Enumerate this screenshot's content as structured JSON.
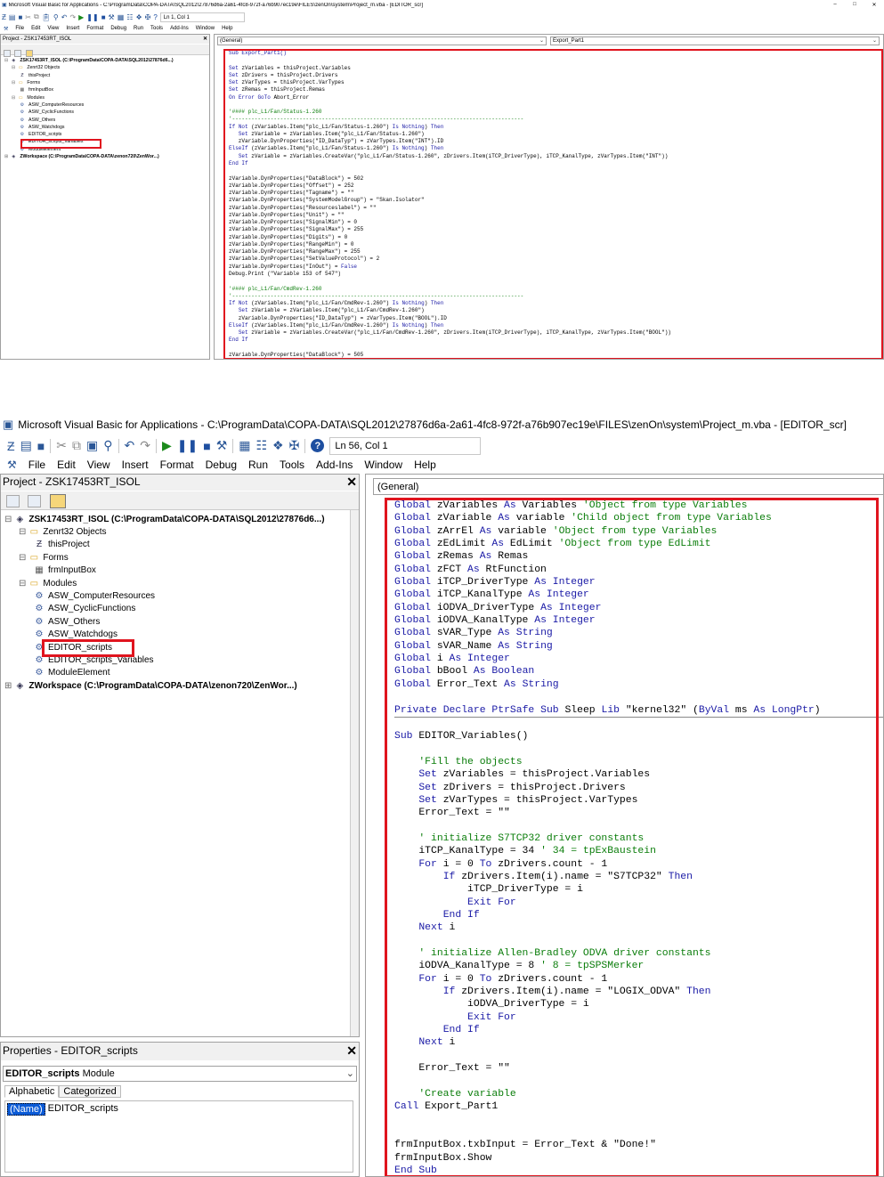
{
  "window1": {
    "title": "Microsoft Visual Basic for Applications - C:\\ProgramData\\COPA-DATA\\SQL2012\\27876d6a-2a61-4fc8-972f-a76b907ec19e\\FILES\\zenOn\\system\\Project_m.vba - [EDITOR_scr]",
    "window_buttons": [
      "–",
      "□",
      "✕"
    ],
    "status": "Ln 1, Col 1",
    "menu": [
      "File",
      "Edit",
      "View",
      "Insert",
      "Format",
      "Debug",
      "Run",
      "Tools",
      "Add-Ins",
      "Window",
      "Help"
    ],
    "project_title": "Project - ZSK17453RT_ISOL",
    "tree": [
      {
        "label": "ZSK17453RT_ISOL (C:\\ProgramData\\COPA-DATA\\SQL2012\\27876d6...)",
        "icon": "project-icon",
        "bold": true,
        "level": 0
      },
      {
        "label": "Zenrt32 Objects",
        "icon": "folder-icon",
        "level": 1
      },
      {
        "label": "thisProject",
        "icon": "object-icon",
        "level": 2
      },
      {
        "label": "Forms",
        "icon": "folder-icon",
        "level": 1
      },
      {
        "label": "frmInputBox",
        "icon": "form-icon",
        "level": 2
      },
      {
        "label": "Modules",
        "icon": "folder-icon",
        "level": 1
      },
      {
        "label": "ASW_ComputerResources",
        "icon": "module-icon",
        "level": 2
      },
      {
        "label": "ASW_CyclicFunctions",
        "icon": "module-icon",
        "level": 2
      },
      {
        "label": "ASW_Others",
        "icon": "module-icon",
        "level": 2
      },
      {
        "label": "ASW_Watchdogs",
        "icon": "module-icon",
        "level": 2
      },
      {
        "label": "EDITOR_scripts",
        "icon": "module-icon",
        "level": 2
      },
      {
        "label": "EDITOR_scripts_Variables",
        "icon": "module-icon",
        "level": 2
      },
      {
        "label": "ModuleElement",
        "icon": "module-icon",
        "level": 2
      },
      {
        "label": "ZWorkspace (C:\\ProgramData\\COPA-DATA\\zenon720\\ZenWor...)",
        "icon": "project-icon",
        "bold": true,
        "level": 0
      }
    ],
    "combo_left": "(General)",
    "combo_right": "Export_Part1",
    "code": [
      {
        "t": "Sub Export_Part1()",
        "c": "kw"
      },
      {
        "t": "",
        "c": ""
      },
      {
        "t": "Set zVariables = thisProject.Variables",
        "c": ""
      },
      {
        "t": "Set zDrivers = thisProject.Drivers",
        "c": ""
      },
      {
        "t": "Set zVarTypes = thisProject.VarTypes",
        "c": ""
      },
      {
        "t": "Set zRemas = thisProject.Remas",
        "c": ""
      },
      {
        "t": "On Error GoTo Abort_Error",
        "c": ""
      },
      {
        "t": "",
        "c": ""
      },
      {
        "t": "'#### plc_L1/Fan/Status-1.260",
        "c": "cm"
      },
      {
        "t": "'-------------------------------------------------------------------------------------------",
        "c": "cm"
      },
      {
        "t": "If Not (zVariables.Item(\"plc_L1/Fan/Status-1.260\") Is Nothing) Then",
        "c": ""
      },
      {
        "t": "   Set zVariable = zVariables.Item(\"plc_L1/Fan/Status-1.260\")",
        "c": ""
      },
      {
        "t": "   zVariable.DynProperties(\"ID_DataTyp\") = zVarTypes.Item(\"INT\").ID",
        "c": ""
      },
      {
        "t": "ElseIf (zVariables.Item(\"plc_L1/Fan/Status-1.260\") Is Nothing) Then",
        "c": ""
      },
      {
        "t": "   Set zVariable = zVariables.CreateVar(\"plc_L1/Fan/Status-1.260\", zDrivers.Item(iTCP_DriverType), iTCP_KanalType, zVarTypes.Item(\"INT\"))",
        "c": ""
      },
      {
        "t": "End If",
        "c": ""
      },
      {
        "t": "",
        "c": ""
      },
      {
        "t": "zVariable.DynProperties(\"DataBlock\") = 502",
        "c": ""
      },
      {
        "t": "zVariable.DynProperties(\"Offset\") = 252",
        "c": ""
      },
      {
        "t": "zVariable.DynProperties(\"Tagname\") = \"\"",
        "c": ""
      },
      {
        "t": "zVariable.DynProperties(\"SystemModelGroup\") = \"Skan.Isolator\"",
        "c": ""
      },
      {
        "t": "zVariable.DynProperties(\"Resourceslabel\") = \"\"",
        "c": ""
      },
      {
        "t": "zVariable.DynProperties(\"Unit\") = \"\"",
        "c": ""
      },
      {
        "t": "zVariable.DynProperties(\"SignalMin\") = 0",
        "c": ""
      },
      {
        "t": "zVariable.DynProperties(\"SignalMax\") = 255",
        "c": ""
      },
      {
        "t": "zVariable.DynProperties(\"Digits\") = 0",
        "c": ""
      },
      {
        "t": "zVariable.DynProperties(\"RangeMin\") = 0",
        "c": ""
      },
      {
        "t": "zVariable.DynProperties(\"RangeMax\") = 255",
        "c": ""
      },
      {
        "t": "zVariable.DynProperties(\"SetValueProtocol\") = 2",
        "c": ""
      },
      {
        "t": "zVariable.DynProperties(\"InOut\") = False",
        "c": ""
      },
      {
        "t": "Debug.Print (\"Variable 153 of 547\")",
        "c": ""
      },
      {
        "t": "",
        "c": ""
      },
      {
        "t": "'#### plc_L1/Fan/CmdRev-1.260",
        "c": "cm"
      },
      {
        "t": "'-------------------------------------------------------------------------------------------",
        "c": "cm"
      },
      {
        "t": "If Not (zVariables.Item(\"plc_L1/Fan/CmdRev-1.260\") Is Nothing) Then",
        "c": ""
      },
      {
        "t": "   Set zVariable = zVariables.Item(\"plc_L1/Fan/CmdRev-1.260\")",
        "c": ""
      },
      {
        "t": "   zVariable.DynProperties(\"ID_DataTyp\") = zVarTypes.Item(\"BOOL\").ID",
        "c": ""
      },
      {
        "t": "ElseIf (zVariables.Item(\"plc_L1/Fan/CmdRev-1.260\") Is Nothing) Then",
        "c": ""
      },
      {
        "t": "   Set zVariable = zVariables.CreateVar(\"plc_L1/Fan/CmdRev-1.260\", zDrivers.Item(iTCP_DriverType), iTCP_KanalType, zVarTypes.Item(\"BOOL\"))",
        "c": ""
      },
      {
        "t": "End If",
        "c": ""
      },
      {
        "t": "",
        "c": ""
      },
      {
        "t": "zVariable.DynProperties(\"DataBlock\") = 505",
        "c": ""
      }
    ]
  },
  "window2": {
    "title": "Microsoft Visual Basic for Applications - C:\\ProgramData\\COPA-DATA\\SQL2012\\27876d6a-2a61-4fc8-972f-a76b907ec19e\\FILES\\zenOn\\system\\Project_m.vba - [EDITOR_scr]",
    "status": "Ln 56, Col 1",
    "menu": [
      "File",
      "Edit",
      "View",
      "Insert",
      "Format",
      "Debug",
      "Run",
      "Tools",
      "Add-Ins",
      "Window",
      "Help"
    ],
    "project_title": "Project - ZSK17453RT_ISOL",
    "tree": [
      {
        "label": "ZSK17453RT_ISOL (C:\\ProgramData\\COPA-DATA\\SQL2012\\27876d6...)",
        "icon": "project-icon",
        "bold": true,
        "level": 0
      },
      {
        "label": "Zenrt32 Objects",
        "icon": "folder-icon",
        "level": 1
      },
      {
        "label": "thisProject",
        "icon": "object-icon",
        "level": 2
      },
      {
        "label": "Forms",
        "icon": "folder-icon",
        "level": 1
      },
      {
        "label": "frmInputBox",
        "icon": "form-icon",
        "level": 2
      },
      {
        "label": "Modules",
        "icon": "folder-icon",
        "level": 1
      },
      {
        "label": "ASW_ComputerResources",
        "icon": "module-icon",
        "level": 2
      },
      {
        "label": "ASW_CyclicFunctions",
        "icon": "module-icon",
        "level": 2
      },
      {
        "label": "ASW_Others",
        "icon": "module-icon",
        "level": 2
      },
      {
        "label": "ASW_Watchdogs",
        "icon": "module-icon",
        "level": 2
      },
      {
        "label": "EDITOR_scripts",
        "icon": "module-icon",
        "level": 2
      },
      {
        "label": "EDITOR_scripts_Variables",
        "icon": "module-icon",
        "level": 2
      },
      {
        "label": "ModuleElement",
        "icon": "module-icon",
        "level": 2
      },
      {
        "label": "ZWorkspace (C:\\ProgramData\\COPA-DATA\\zenon720\\ZenWor...)",
        "icon": "project-icon",
        "bold": true,
        "level": 0
      }
    ],
    "properties": {
      "title": "Properties - EDITOR_scripts",
      "object_name": "EDITOR_scripts",
      "object_type": "Module",
      "tabs": [
        "Alphabetic",
        "Categorized"
      ],
      "rows": [
        {
          "name": "(Name)",
          "value": "EDITOR_scripts"
        }
      ]
    },
    "combo_left": "(General)",
    "code": [
      {
        "t": "Global zVariables As Variables 'Object from type Variables",
        "c": "mix"
      },
      {
        "t": "Global zVariable As variable 'Child object from type Variables",
        "c": "mix"
      },
      {
        "t": "Global zArrEl As variable 'Object from type Variables",
        "c": "mix"
      },
      {
        "t": "Global zEdLimit As EdLimit 'Object from type EdLimit",
        "c": "mix"
      },
      {
        "t": "Global zRemas As Remas",
        "c": "mix"
      },
      {
        "t": "Global zFCT As RtFunction",
        "c": "mix"
      },
      {
        "t": "Global iTCP_DriverType As Integer",
        "c": "mix"
      },
      {
        "t": "Global iTCP_KanalType As Integer",
        "c": "mix"
      },
      {
        "t": "Global iODVA_DriverType As Integer",
        "c": "mix"
      },
      {
        "t": "Global iODVA_KanalType As Integer",
        "c": "mix"
      },
      {
        "t": "Global sVAR_Type As String",
        "c": "mix"
      },
      {
        "t": "Global sVAR_Name As String",
        "c": "mix"
      },
      {
        "t": "Global i As Integer",
        "c": "mix"
      },
      {
        "t": "Global bBool As Boolean",
        "c": "mix"
      },
      {
        "t": "Global Error_Text As String",
        "c": "mix"
      },
      {
        "t": "",
        "c": ""
      },
      {
        "t": "Private Declare PtrSafe Sub Sleep Lib \"kernel32\" (ByVal ms As LongPtr)",
        "c": "mix"
      },
      {
        "t": "",
        "c": "sepline"
      },
      {
        "t": "Sub EDITOR_Variables()",
        "c": "mix"
      },
      {
        "t": "",
        "c": ""
      },
      {
        "t": "    'Fill the objects",
        "c": "cm"
      },
      {
        "t": "    Set zVariables = thisProject.Variables",
        "c": ""
      },
      {
        "t": "    Set zDrivers = thisProject.Drivers",
        "c": ""
      },
      {
        "t": "    Set zVarTypes = thisProject.VarTypes",
        "c": ""
      },
      {
        "t": "    Error_Text = \"\"",
        "c": ""
      },
      {
        "t": "",
        "c": ""
      },
      {
        "t": "    ' initialize S7TCP32 driver constants",
        "c": "cm"
      },
      {
        "t": "    iTCP_KanalType = 34 ' 34 = tpExBaustein",
        "c": "mix"
      },
      {
        "t": "    For i = 0 To zDrivers.count - 1",
        "c": ""
      },
      {
        "t": "        If zDrivers.Item(i).name = \"S7TCP32\" Then",
        "c": ""
      },
      {
        "t": "            iTCP_DriverType = i",
        "c": ""
      },
      {
        "t": "            Exit For",
        "c": ""
      },
      {
        "t": "        End If",
        "c": ""
      },
      {
        "t": "    Next i",
        "c": ""
      },
      {
        "t": "",
        "c": ""
      },
      {
        "t": "    ' initialize Allen-Bradley ODVA driver constants",
        "c": "cm"
      },
      {
        "t": "    iODVA_KanalType = 8 ' 8 = tpSPSMerker",
        "c": "mix"
      },
      {
        "t": "    For i = 0 To zDrivers.count - 1",
        "c": ""
      },
      {
        "t": "        If zDrivers.Item(i).name = \"LOGIX_ODVA\" Then",
        "c": ""
      },
      {
        "t": "            iODVA_DriverType = i",
        "c": ""
      },
      {
        "t": "            Exit For",
        "c": ""
      },
      {
        "t": "        End If",
        "c": ""
      },
      {
        "t": "    Next i",
        "c": ""
      },
      {
        "t": "",
        "c": ""
      },
      {
        "t": "    Error_Text = \"\"",
        "c": ""
      },
      {
        "t": "",
        "c": ""
      },
      {
        "t": "    'Create variable",
        "c": "cm"
      },
      {
        "t": "Call Export_Part1",
        "c": ""
      },
      {
        "t": "",
        "c": ""
      },
      {
        "t": "",
        "c": ""
      },
      {
        "t": "frmInputBox.txbInput = Error_Text & \"Done!\"",
        "c": ""
      },
      {
        "t": "frmInputBox.Show",
        "c": ""
      },
      {
        "t": "End Sub",
        "c": ""
      }
    ]
  },
  "colors": {
    "highlight": "#e0141e",
    "keyword": "#1a1aa6",
    "comment": "#0a7d0a"
  }
}
